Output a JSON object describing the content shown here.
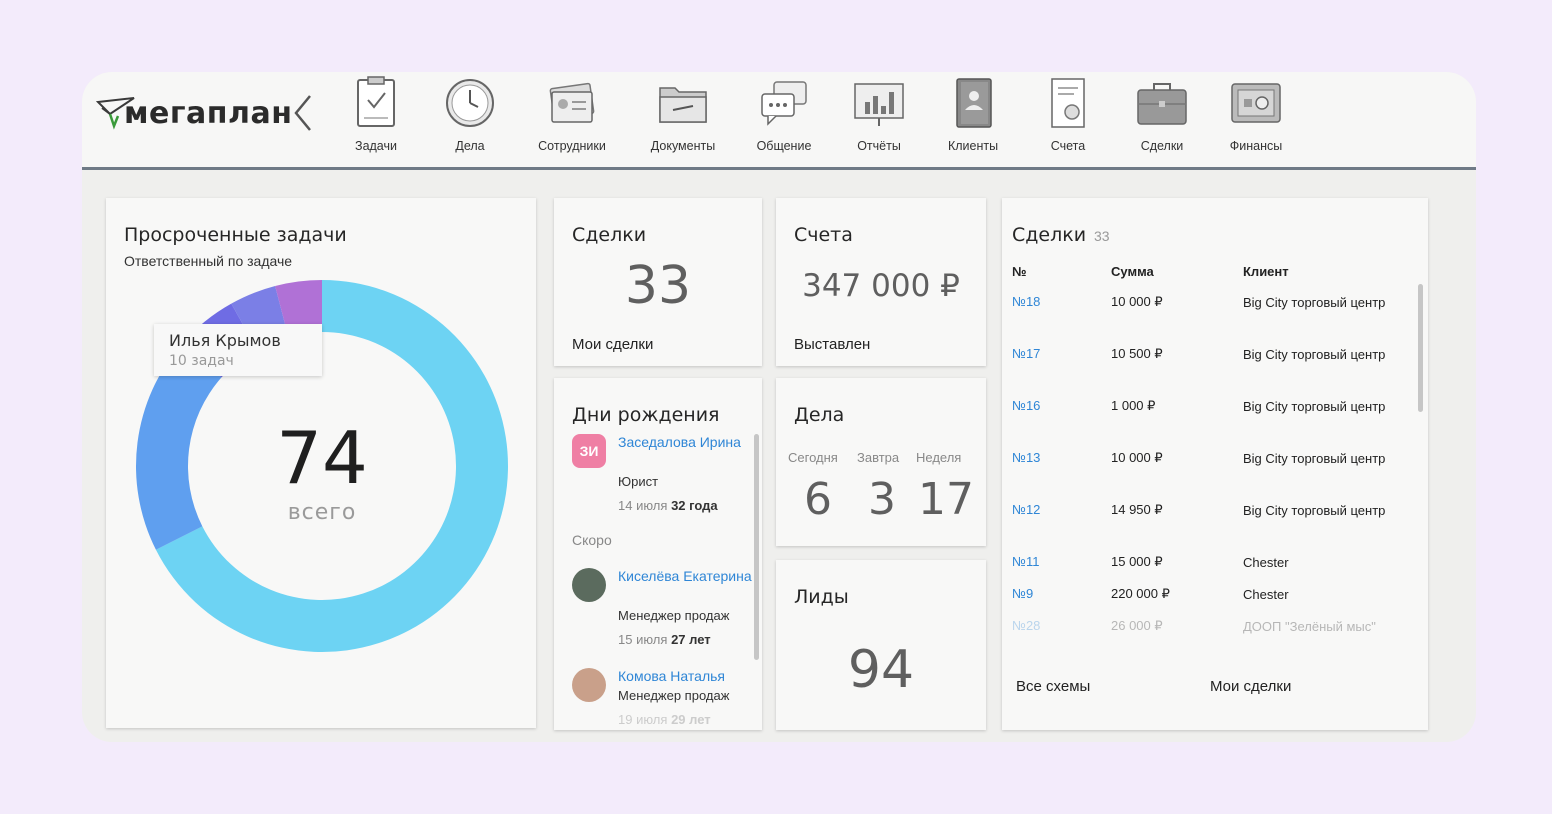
{
  "brand": {
    "name": "мегаплан"
  },
  "nav": [
    {
      "label": "Задачи",
      "icon": "clipboard-check-icon"
    },
    {
      "label": "Дела",
      "icon": "clock-icon"
    },
    {
      "label": "Сотрудники",
      "icon": "id-cards-icon"
    },
    {
      "label": "Документы",
      "icon": "folder-icon"
    },
    {
      "label": "Общение",
      "icon": "chat-bubbles-icon"
    },
    {
      "label": "Отчёты",
      "icon": "bar-chart-board-icon"
    },
    {
      "label": "Клиенты",
      "icon": "address-book-icon"
    },
    {
      "label": "Счета",
      "icon": "invoice-document-icon"
    },
    {
      "label": "Сделки",
      "icon": "briefcase-icon"
    },
    {
      "label": "Финансы",
      "icon": "safe-icon"
    }
  ],
  "overdue": {
    "title": "Просроченные задачи",
    "subtitle": "Ответственный по задаче",
    "total": "74",
    "caption": "всего",
    "tooltip": {
      "name": "Илья Крымов",
      "count": "10 задач"
    },
    "segments": [
      {
        "value": 50,
        "color": "#6dd3f3"
      },
      {
        "value": 14,
        "color": "#5f9fef"
      },
      {
        "value": 4,
        "color": "#6f6ce4"
      },
      {
        "value": 3,
        "color": "#7b7fe6"
      },
      {
        "value": 3,
        "color": "#b071d6"
      }
    ]
  },
  "deals_card": {
    "title": "Сделки",
    "value": "33",
    "link": "Мои сделки"
  },
  "invoices_card": {
    "title": "Счета",
    "value": "347 000 ₽",
    "link": "Выставлен"
  },
  "birthdays": {
    "title": "Дни рождения",
    "soon_label": "Скоро",
    "people": [
      {
        "initials": "ЗИ",
        "name": "Заседалова Ирина",
        "role": "Юрист",
        "date": "14 июля",
        "age": "32 года",
        "avatar_color": "#ef7fa4"
      },
      {
        "name": "Киселёва Екатерина",
        "role": "Менеджер продаж",
        "date": "15 июля",
        "age": "27 лет",
        "avatar_color": "#5b6b5e"
      },
      {
        "name": "Комова Наталья",
        "role": "Менеджер продаж",
        "date": "19 июля",
        "age": "29 лет",
        "avatar_color": "#c9a08a"
      }
    ]
  },
  "tasks_card": {
    "title": "Дела",
    "cols": [
      {
        "label": "Сегодня",
        "value": "6"
      },
      {
        "label": "Завтра",
        "value": "3"
      },
      {
        "label": "Неделя",
        "value": "17"
      }
    ]
  },
  "leads_card": {
    "title": "Лиды",
    "value": "94"
  },
  "deals_table": {
    "title": "Сделки",
    "count": "33",
    "headers": {
      "no": "№",
      "sum": "Сумма",
      "client": "Клиент"
    },
    "rows": [
      {
        "no": "№18",
        "sum": "10 000 ₽",
        "client": "Big City торговый центр"
      },
      {
        "no": "№17",
        "sum": "10 500 ₽",
        "client": "Big City торговый центр"
      },
      {
        "no": "№16",
        "sum": "1 000 ₽",
        "client": "Big City торговый центр"
      },
      {
        "no": "№13",
        "sum": "10 000 ₽",
        "client": "Big City торговый центр"
      },
      {
        "no": "№12",
        "sum": "14 950 ₽",
        "client": "Big City торговый центр"
      },
      {
        "no": "№11",
        "sum": "15 000 ₽",
        "client": "Chester"
      },
      {
        "no": "№9",
        "sum": "220 000 ₽",
        "client": "Chester"
      },
      {
        "no": "№28",
        "sum": "26 000 ₽",
        "client": "ДООП \"Зелёный мыс\""
      }
    ],
    "footer_left": "Все схемы",
    "footer_right": "Мои сделки"
  }
}
